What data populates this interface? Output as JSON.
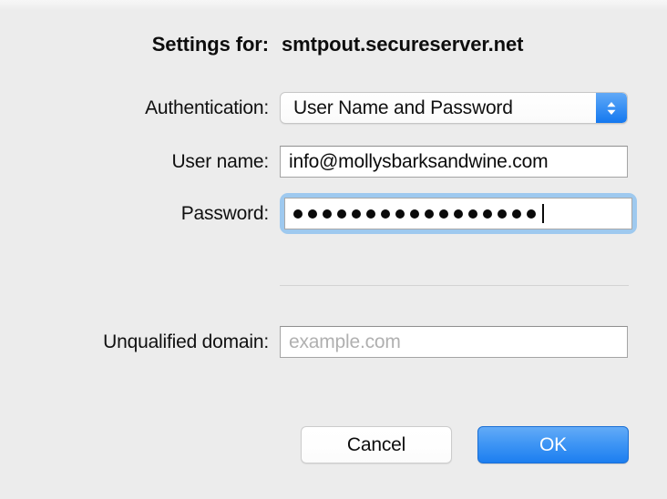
{
  "dialog": {
    "title_label": "Settings for:",
    "title_value": "smtpout.secureserver.net",
    "rows": {
      "authentication": {
        "label": "Authentication:",
        "value": "User Name and Password",
        "stepper_icon": "chevron-up-down-icon"
      },
      "user_name": {
        "label": "User name:",
        "value": "info@mollysbarksandwine.com"
      },
      "password": {
        "label": "Password:",
        "masked_character": "●",
        "masked_length": 17,
        "focused": true,
        "caret_visible": true
      },
      "unqualified_domain": {
        "label": "Unqualified domain:",
        "value": "",
        "placeholder": "example.com"
      }
    },
    "buttons": {
      "cancel": "Cancel",
      "ok": "OK"
    },
    "colors": {
      "background": "#ececec",
      "accent_blue": "#1c7ef0",
      "focus_ring": "#9ec9ef",
      "placeholder_text": "#b0b0b0",
      "separator": "#d3d3d3"
    }
  }
}
